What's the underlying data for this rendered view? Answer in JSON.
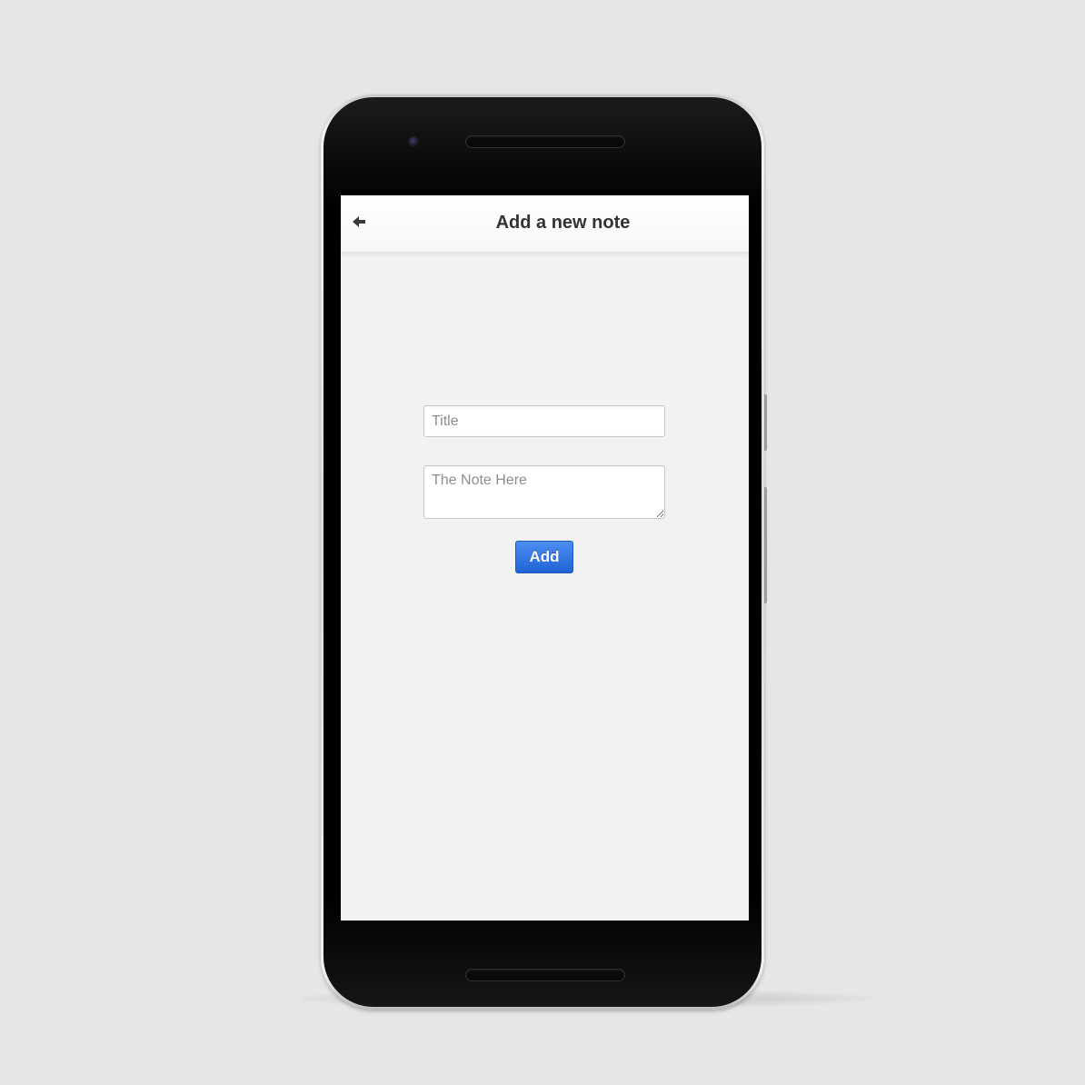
{
  "header": {
    "title": "Add a new note",
    "back_icon": "arrow-left-icon"
  },
  "form": {
    "title_placeholder": "Title",
    "note_placeholder": "The Note Here",
    "add_label": "Add"
  },
  "colors": {
    "background": "#e6e6e6",
    "screen": "#f2f2f2",
    "accent": "#1f63d6"
  }
}
